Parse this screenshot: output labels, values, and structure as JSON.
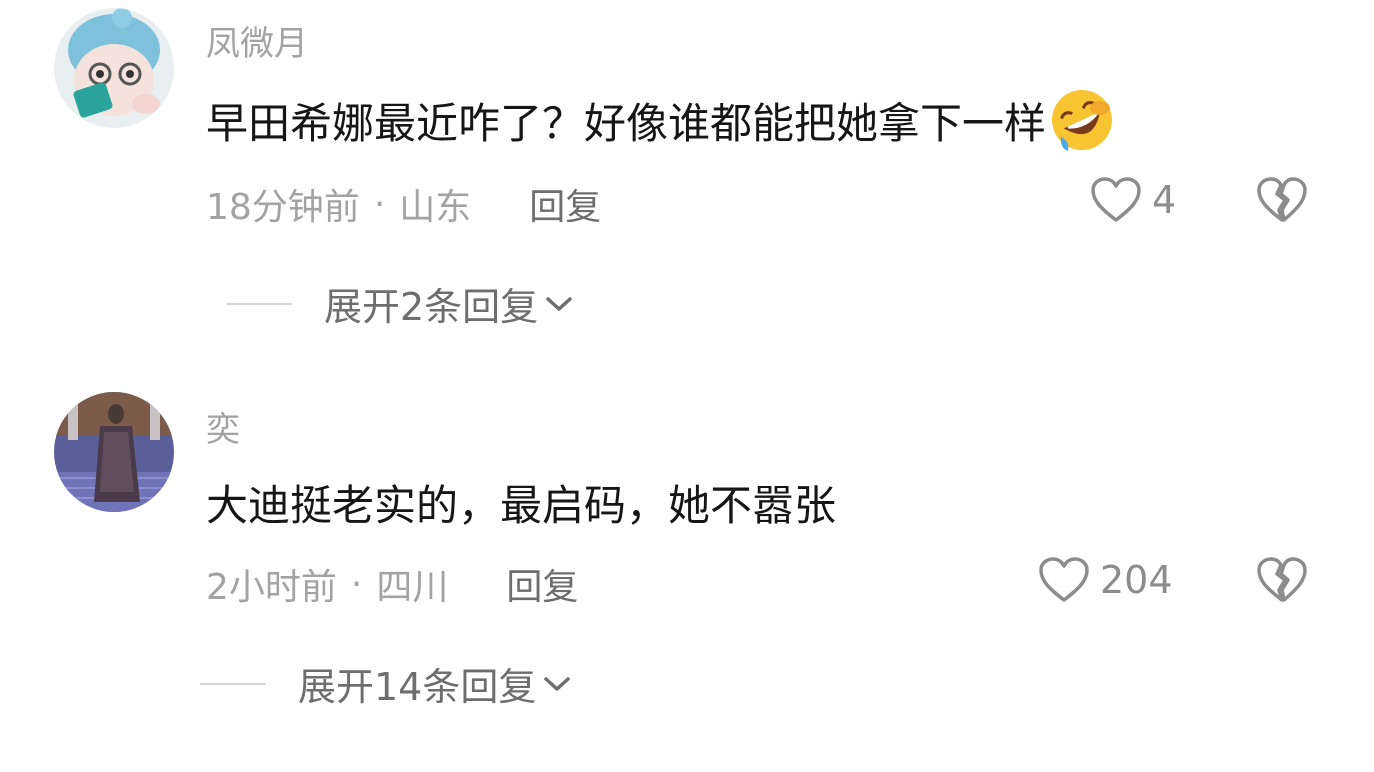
{
  "comments": [
    {
      "username": "凤微月",
      "text": "早田希娜最近咋了？好像谁都能把她拿下一样",
      "emoji": "rolling-on-floor-laughing-emoji",
      "time": "18分钟前",
      "dot": "·",
      "location": "山东",
      "reply_label": "回复",
      "likes": "4",
      "expand_label": "展开2条回复"
    },
    {
      "username": "奕",
      "text": "大迪挺老实的，最启码，她不嚣张",
      "time": "2小时前",
      "dot": "·",
      "location": "四川",
      "reply_label": "回复",
      "likes": "204",
      "expand_label": "展开14条回复"
    }
  ],
  "colors": {
    "secondary_text": "#a3a3a3",
    "primary_text": "#161616",
    "action_text": "#6e6e6e",
    "icon": "#8c8c8c"
  }
}
